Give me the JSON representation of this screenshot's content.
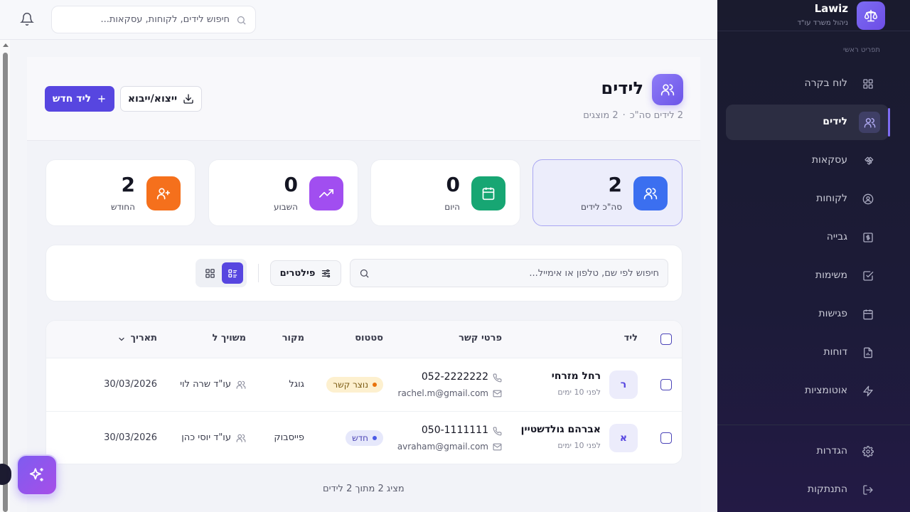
{
  "brand": {
    "name": "Lawiz",
    "subtitle": "ניהול משרד עו\"ד"
  },
  "sidebar": {
    "section_title": "תפריט ראשי",
    "items": [
      {
        "label": "לוח בקרה",
        "icon": "dashboard-icon"
      },
      {
        "label": "לידים",
        "icon": "users-icon",
        "active": true
      },
      {
        "label": "עסקאות",
        "icon": "handshake-icon"
      },
      {
        "label": "לקוחות",
        "icon": "user-circle-icon"
      },
      {
        "label": "גבייה",
        "icon": "dollar-icon"
      },
      {
        "label": "משימות",
        "icon": "task-check-icon"
      },
      {
        "label": "פגישות",
        "icon": "calendar-icon"
      },
      {
        "label": "דוחות",
        "icon": "report-file-icon"
      },
      {
        "label": "אוטומציות",
        "icon": "lightning-icon"
      }
    ],
    "bottom_items": [
      {
        "label": "הגדרות",
        "icon": "gear-icon"
      },
      {
        "label": "התנתקות",
        "icon": "logout-icon"
      }
    ]
  },
  "topbar": {
    "search_placeholder": "חיפוש לידים, לקוחות, עסקאות..."
  },
  "page": {
    "title": "לידים",
    "total_text": "2 לידים סה\"כ",
    "shown_text": "2 מוצגים",
    "new_button": "ליד חדש",
    "export_button": "ייצוא/ייבוא"
  },
  "stats": [
    {
      "value": "2",
      "label": "סה\"כ לידים",
      "color": "#3b6ff0"
    },
    {
      "value": "0",
      "label": "היום",
      "color": "#17a673"
    },
    {
      "value": "0",
      "label": "השבוע",
      "color": "#a14ef0"
    },
    {
      "value": "2",
      "label": "החודש",
      "color": "#f5701c"
    }
  ],
  "filters": {
    "search_placeholder": "חיפוש לפי שם, טלפון או אימייל...",
    "filters_button": "פילטרים"
  },
  "table": {
    "columns": {
      "lead": "ליד",
      "contact": "פרטי קשר",
      "status": "סטטוס",
      "source": "מקור",
      "assigned": "משויך ל",
      "date": "תאריך"
    },
    "rows": [
      {
        "initial": "ר",
        "name": "רחל מזרחי",
        "time": "לפני 10 ימים",
        "phone": "052-2222222",
        "email": "rachel.m@gmail.com",
        "status": "נוצר קשר",
        "source": "גוגל",
        "assigned": "עו\"ד שרה לוי",
        "date": "30/03/2026"
      },
      {
        "initial": "א",
        "name": "אברהם גולדשטיין",
        "time": "לפני 10 ימים",
        "phone": "050-1111111",
        "email": "avraham@gmail.com",
        "status": "חדש",
        "source": "פייסבוק",
        "assigned": "עו\"ד יוסי כהן",
        "date": "30/03/2026"
      }
    ],
    "footer": "מציג 2 מתוך 2 לידים"
  },
  "colors": {
    "accent": "#5746e0",
    "sidebar_bg": "#1a1b2e"
  }
}
